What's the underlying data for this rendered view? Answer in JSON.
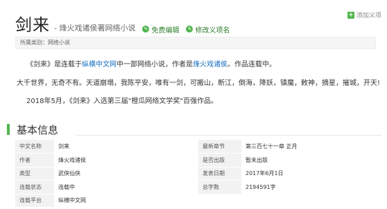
{
  "header": {
    "add_synonym_label": "添加义项",
    "title": "剑来",
    "subtitle": "- 烽火戏诸侯著网络小说",
    "free_edit_label": "免费编辑",
    "edit_item_name_label": "修改义项名"
  },
  "category": {
    "text": "所属类别：网络小说"
  },
  "summary": {
    "p1_a": "《剑来》是连载于",
    "p1_link1": "纵横中文网",
    "p1_b": "中一部网络小说，作者是",
    "p1_link2": "烽火戏诸侯",
    "p1_c": "。作品连载中。",
    "p2": "大千世界，无奇不有。天道崩塌，我陈平安，唯有一剑，可搬山，断江，倒海，降妖，镇魔，敕神，摘星，摧城，开天!",
    "p3": "2018年5月，《剑来》入选第三届\"橙瓜网络文学奖\"百强作品。"
  },
  "basic_info": {
    "section_title": "基本信息",
    "rows": [
      {
        "l1": "中文名称",
        "v1": "剑来",
        "l2": "最新章节",
        "v2": "第三百七十一章 正月"
      },
      {
        "l1": "作者",
        "v1": "烽火戏诸侯",
        "l2": "是否出版",
        "v2": "暂未出版"
      },
      {
        "l1": "类型",
        "v1": "武侠仙侠",
        "l2": "发表日期",
        "v2": "2017年6月1日"
      },
      {
        "l1": "连载状态",
        "v1": "连载中",
        "l2": "总字数",
        "v2": "2194591字"
      },
      {
        "l1": "连载平台",
        "v1": "纵横中文网",
        "l2": "",
        "v2": ""
      }
    ]
  }
}
